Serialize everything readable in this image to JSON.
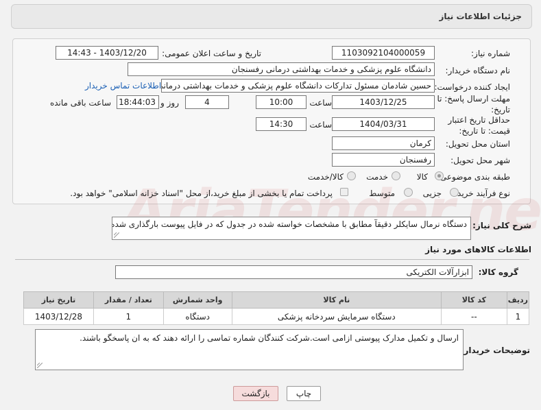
{
  "header": {
    "title": "جزئیات اطلاعات نیاز"
  },
  "form": {
    "need_number_label": "شماره نیاز:",
    "need_number": "1103092104000059",
    "announce_label": "تاریخ و ساعت اعلان عمومی:",
    "announce_value": "1403/12/20 - 14:43",
    "buyer_org_label": "نام دستگاه خریدار:",
    "buyer_org": "دانشگاه علوم پزشکی و خدمات بهداشتی درمانی رفسنجان",
    "creator_label": "ایجاد کننده درخواست:",
    "creator": "حسین شادمان مسئول تدارکات دانشگاه علوم پزشکی و خدمات بهداشتی درمانی",
    "contact_link": "اطلاعات تماس خریدار",
    "reply_deadline_label": "مهلت ارسال پاسخ: تا تاریخ:",
    "reply_date": "1403/12/25",
    "time_label": "ساعت",
    "reply_time": "10:00",
    "days_value": "4",
    "days_label": "روز و",
    "remaining_time": "18:44:03",
    "remaining_label": "ساعت باقی مانده",
    "price_validity_label": "حداقل تاریخ اعتبار قیمت: تا تاریخ:",
    "validity_date": "1404/03/31",
    "validity_time": "14:30",
    "province_label": "استان محل تحویل:",
    "province": "کرمان",
    "city_label": "شهر محل تحویل:",
    "city": "رفسنجان",
    "category_label": "طبقه بندی موضوعی:",
    "category_options": [
      "کالا",
      "خدمت",
      "کالا/خدمت"
    ],
    "process_label": "نوع فرآیند خرید :",
    "process_options": [
      "جزیی",
      "متوسط"
    ],
    "payment_note": "پرداخت تمام یا بخشی از مبلغ خرید،از محل \"اسناد خزانه اسلامی\" خواهد بود."
  },
  "description": {
    "label": "شرح کلی نیاز:",
    "text": "دستگاه نرمال سایکلر دقیقآ مطابق با مشخصات خواسته شده در جدول که در فایل پیوست بارگذاری شده-"
  },
  "goods": {
    "section_title": "اطلاعات کالاهای مورد نیاز",
    "group_label": "گروه کالا:",
    "group_value": "ابزارآلات الکتریکی",
    "columns": [
      "ردیف",
      "کد کالا",
      "نام کالا",
      "واحد شمارش",
      "تعداد / مقدار",
      "تاریخ نیاز"
    ],
    "rows": [
      [
        "1",
        "--",
        "دستگاه سرمایش سردخانه پزشکی",
        "دستگاه",
        "1",
        "1403/12/28"
      ]
    ]
  },
  "buyer_notes": {
    "label": "توضیحات خریدار:",
    "text": "ارسال و تکمیل مدارک پیوستی ازامی است.شرکت کنندگان شماره تماسی را ارائه دهند که به ان پاسخگو باشند."
  },
  "buttons": {
    "print": "چاپ",
    "back": "بازگشت"
  },
  "watermark": "AriaTender.neT",
  "colors": {
    "link": "#1a5fb4",
    "back_button_bg": "#f6dcdc",
    "print_button_bg": "#ffffff"
  }
}
